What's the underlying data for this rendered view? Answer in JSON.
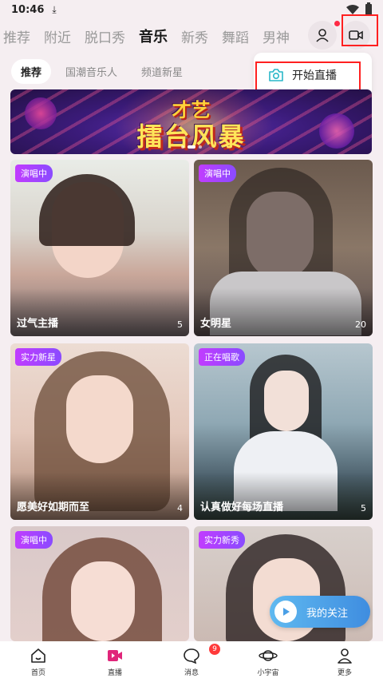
{
  "status_bar": {
    "time": "10:46"
  },
  "top_tabs": [
    {
      "label": "推荐",
      "active": false
    },
    {
      "label": "附近",
      "active": false
    },
    {
      "label": "脱口秀",
      "active": false
    },
    {
      "label": "音乐",
      "active": true
    },
    {
      "label": "新秀",
      "active": false
    },
    {
      "label": "舞蹈",
      "active": false
    },
    {
      "label": "男神",
      "active": false
    }
  ],
  "top_icons": {
    "profile_icon": "user-icon",
    "live_icon": "video-camera-icon",
    "highlight_color": "#ff2020"
  },
  "sub_tabs": [
    {
      "label": "推荐",
      "active": true
    },
    {
      "label": "国潮音乐人",
      "active": false
    },
    {
      "label": "频道新星",
      "active": false
    }
  ],
  "popup": {
    "item_label": "开始直播",
    "icon": "camera-icon"
  },
  "banner": {
    "line1": "才艺",
    "line2": "擂台风暴"
  },
  "cards": [
    {
      "badge": "演唱中",
      "title": "过气主播",
      "count": "5"
    },
    {
      "badge": "演唱中",
      "title": "女明星",
      "count": "20"
    },
    {
      "badge": "实力新星",
      "title": "愿美好如期而至",
      "count": "4"
    },
    {
      "badge": "正在唱歌",
      "title": "认真做好每场直播",
      "count": "5"
    },
    {
      "badge": "演唱中",
      "title": "",
      "count": ""
    },
    {
      "badge": "实力新秀",
      "title": "",
      "count": ""
    }
  ],
  "follow_button": {
    "label": "我的关注"
  },
  "bottom_nav": [
    {
      "label": "首页",
      "icon": "home-icon"
    },
    {
      "label": "直播",
      "icon": "live-icon",
      "active": true
    },
    {
      "label": "消息",
      "icon": "message-icon",
      "badge": "9"
    },
    {
      "label": "小宇宙",
      "icon": "planet-icon"
    },
    {
      "label": "更多",
      "icon": "person-icon"
    }
  ],
  "colors": {
    "accent": "#ff2b45",
    "badge": "#b84cff",
    "live_active": "#e0257a",
    "follow": "#4a9fe6"
  }
}
